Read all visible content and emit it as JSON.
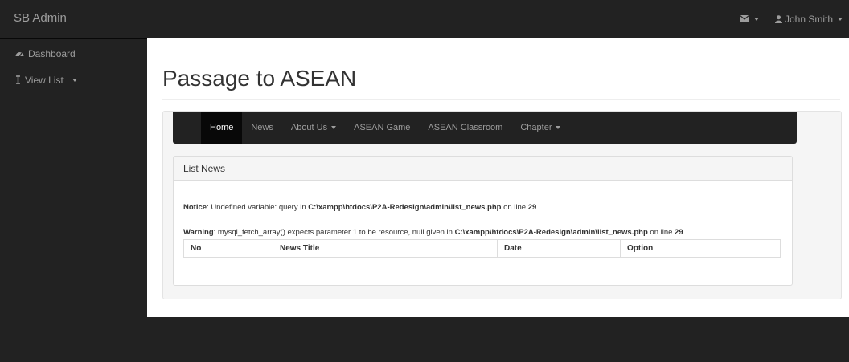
{
  "navbar": {
    "brand": "SB Admin",
    "user_name": "John Smith",
    "icons": {
      "messages": "envelope-icon",
      "user": "user-icon"
    }
  },
  "sidebar": {
    "items": [
      {
        "label": "Dashboard",
        "icon": "dashboard-icon"
      },
      {
        "label": "View List",
        "icon": "list-icon"
      }
    ]
  },
  "page": {
    "title": "Passage to ASEAN"
  },
  "site_nav": {
    "items": [
      {
        "label": "Home",
        "active": true
      },
      {
        "label": "News"
      },
      {
        "label": "About Us",
        "dropdown": true
      },
      {
        "label": "ASEAN Game"
      },
      {
        "label": "ASEAN Classroom"
      },
      {
        "label": "Chapter",
        "dropdown": true
      }
    ]
  },
  "list_panel": {
    "heading": "List News",
    "notice": {
      "label": "Notice",
      "text": ": Undefined variable: query in ",
      "path": "C:\\xampp\\htdocs\\P2A-Redesign\\admin\\list_news.php",
      "suffix": " on line ",
      "line": "29"
    },
    "warning": {
      "label": "Warning",
      "text": ": mysql_fetch_array() expects parameter 1 to be resource, null given in ",
      "path": "C:\\xampp\\htdocs\\P2A-Redesign\\admin\\list_news.php",
      "suffix": " on line ",
      "line": "29"
    },
    "table": {
      "columns": [
        "No",
        "News Title",
        "Date",
        "Option"
      ]
    }
  },
  "colors": {
    "navbar_bg": "#222222",
    "nav_text": "#9d9d9d",
    "active_nav_bg": "#080808"
  }
}
